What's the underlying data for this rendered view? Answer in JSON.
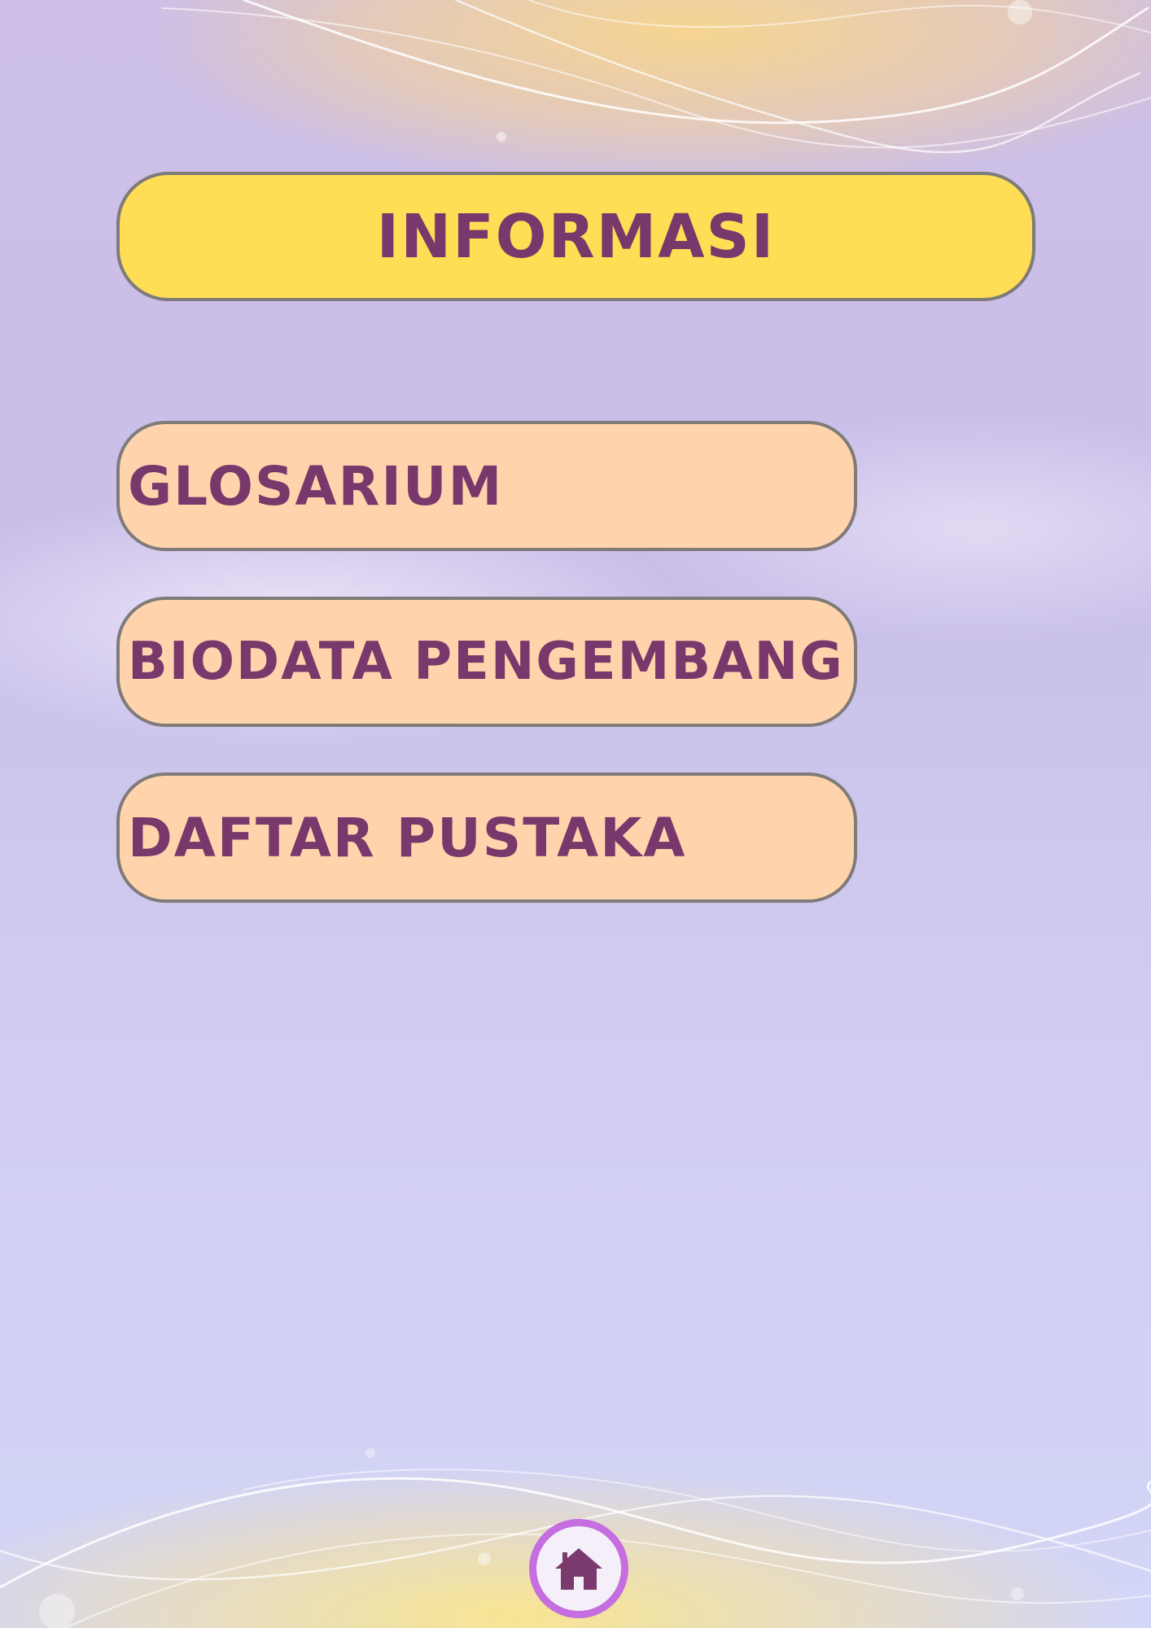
{
  "header": {
    "title": "INFORMASI"
  },
  "menu": {
    "items": [
      {
        "label": "GLOSARIUM"
      },
      {
        "label": "BIODATA PENGEMBANG"
      },
      {
        "label": "DAFTAR PUSTAKA"
      }
    ]
  },
  "footer": {
    "home_icon": "home-icon"
  },
  "colors": {
    "title_background": "#ffdd55",
    "menu_background": "#ffd4ac",
    "text": "#79386b",
    "border": "#7e7b79",
    "home_ring": "#c46ee0"
  }
}
